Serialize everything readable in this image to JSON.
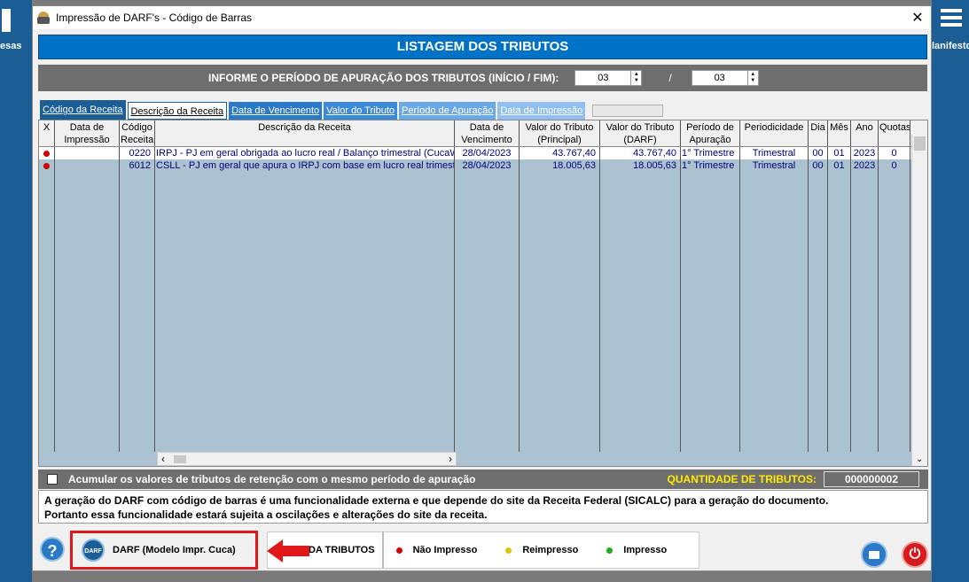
{
  "window": {
    "title": "Impressão de DARF's  -  Código de Barras"
  },
  "background": {
    "left_label": "esas",
    "right_label": "lanifesto"
  },
  "header": {
    "title": "LISTAGEM DOS TRIBUTOS"
  },
  "period": {
    "label": "INFORME O PERÍODO DE APURAÇÃO DOS TRIBUTOS (INÍCIO / FIM):",
    "start_value": "03",
    "separator": "/",
    "end_value": "03"
  },
  "tabs": [
    {
      "label": "Código da Receita"
    },
    {
      "label": "Descrição da Receita"
    },
    {
      "label": "Data de Vencimento"
    },
    {
      "label": "Valor do Tributo"
    },
    {
      "label": "Período de Apuração"
    },
    {
      "label": "Data de Impressão"
    }
  ],
  "table": {
    "columns": [
      {
        "l1": "X",
        "l2": ""
      },
      {
        "l1": "Data de",
        "l2": "Impressão"
      },
      {
        "l1": "Código",
        "l2": "Receita"
      },
      {
        "l1": "Descrição da Receita",
        "l2": ""
      },
      {
        "l1": "Data de",
        "l2": "Vencimento"
      },
      {
        "l1": "Valor do Tributo",
        "l2": "(Principal)"
      },
      {
        "l1": "Valor do Tributo",
        "l2": "(DARF)"
      },
      {
        "l1": "Período de",
        "l2": "Apuração"
      },
      {
        "l1": "Periodicidade",
        "l2": ""
      },
      {
        "l1": "Dia",
        "l2": ""
      },
      {
        "l1": "Mês",
        "l2": ""
      },
      {
        "l1": "Ano",
        "l2": ""
      },
      {
        "l1": "Quotas",
        "l2": ""
      }
    ],
    "rows": [
      {
        "data_impressao": "",
        "codigo": "0220",
        "descricao": "IRPJ - PJ em geral obrigada ao lucro real / Balanço trimestral (CucaWin)",
        "vencimento": "28/04/2023",
        "valor_principal": "43.767,40",
        "valor_darf": "43.767,40",
        "periodo": "1° Trimestre",
        "periodicidade": "Trimestral",
        "dia": "00",
        "mes": "01",
        "ano": "2023",
        "quotas": "0"
      },
      {
        "data_impressao": "",
        "codigo": "6012",
        "descricao": "CSLL - PJ em geral que apura o IRPJ com base em lucro real trimestral",
        "vencimento": "28/04/2023",
        "valor_principal": "18.005,63",
        "valor_darf": "18.005,63",
        "periodo": "1° Trimestre",
        "periodicidade": "Trimestral",
        "dia": "00",
        "mes": "01",
        "ano": "2023",
        "quotas": "0"
      }
    ]
  },
  "accumulate": {
    "label": "Acumular os valores de tributos de retenção com o mesmo período de apuração",
    "checked": false,
    "qty_label": "QUANTIDADE DE TRIBUTOS:",
    "qty_value": "000000002"
  },
  "info": {
    "line1": "A geração do DARF com código de barras é uma funcionalidade externa e que depende do site da Receita Federal (SICALC) para a geração do documento.",
    "line2": "Portanto essa funcionalidade estará sujeita a oscilações e alterações do site da receita."
  },
  "footer": {
    "help_label": "?",
    "darf_icon_text": "DARF",
    "darf_button_label": "DARF (Modelo Impr. Cuca)",
    "legend_tab": "DA TRIBUTOS",
    "legend": [
      {
        "label": "Não Impresso",
        "color": "#cc0000"
      },
      {
        "label": "Reimpresso",
        "color": "#d6c800"
      },
      {
        "label": "Impresso",
        "color": "#22aa22"
      }
    ]
  },
  "colors": {
    "accent": "#0072c6",
    "highlight_box": "#e01818",
    "qty_label": "#ffea00"
  }
}
